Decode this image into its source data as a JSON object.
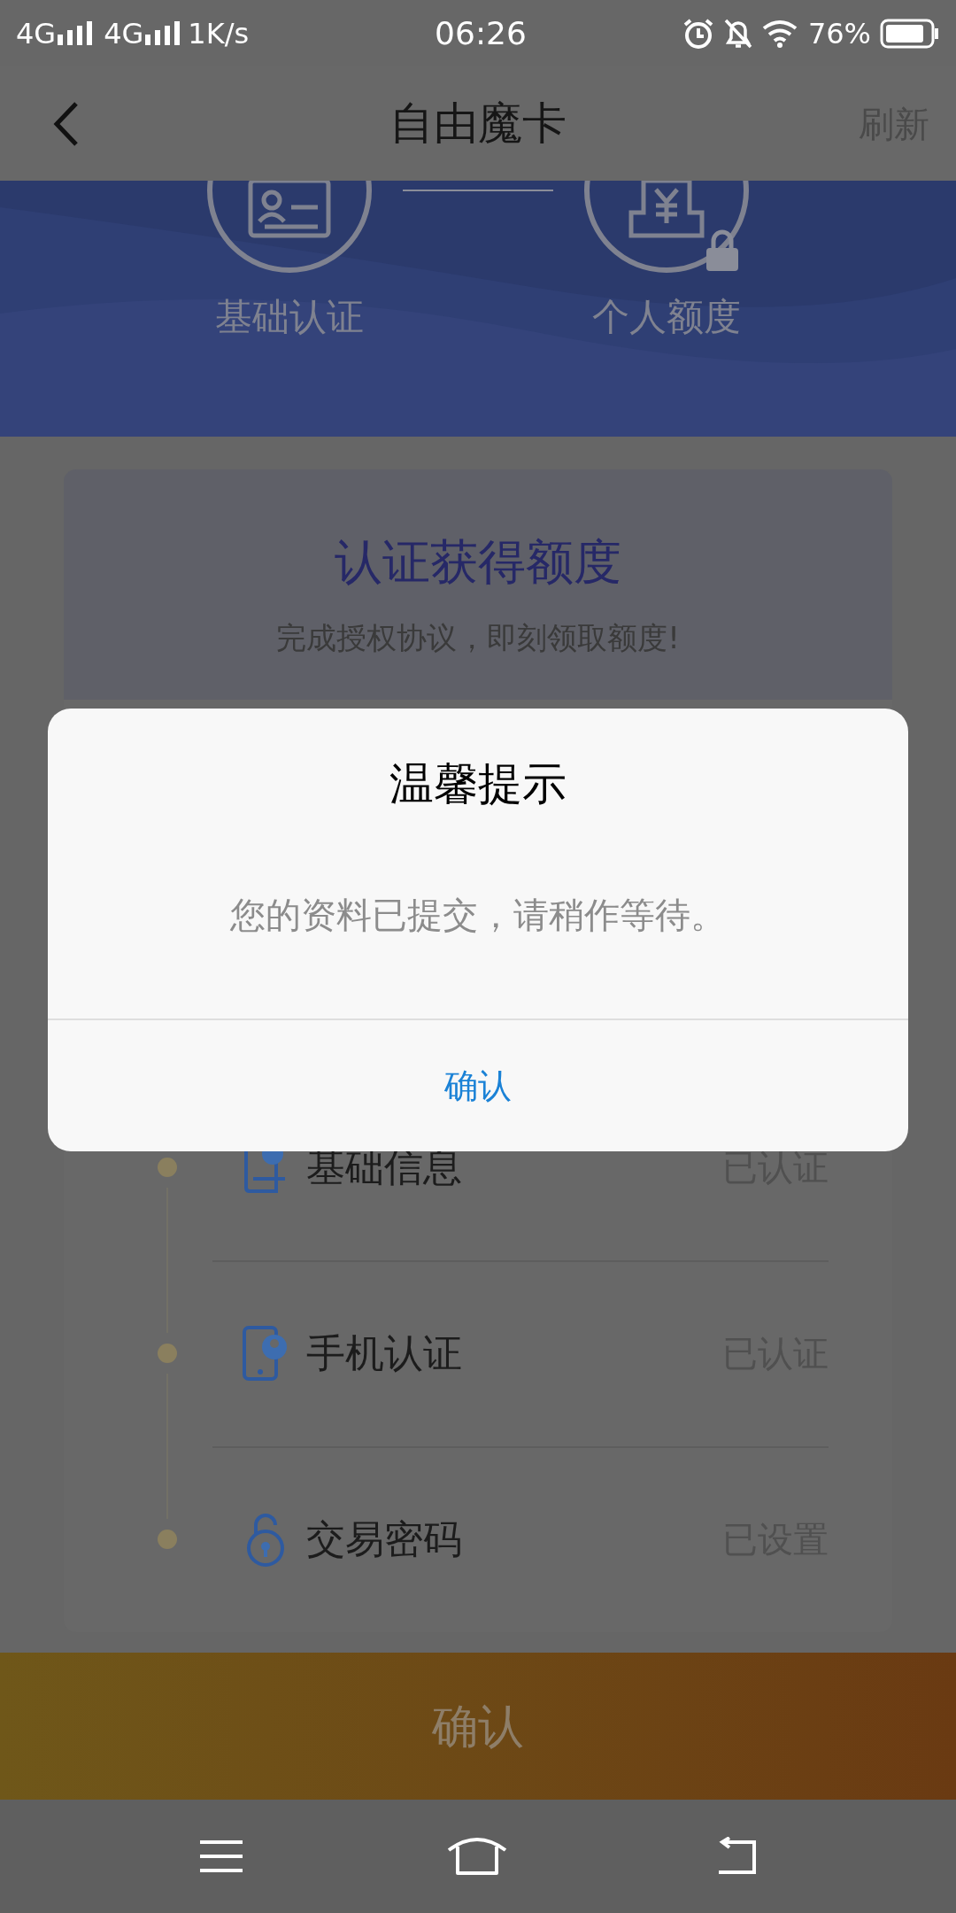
{
  "status_bar": {
    "signal_1": "4G",
    "signal_2": "4G",
    "speed": "1K/s",
    "time": "06:26",
    "battery": "76%"
  },
  "nav": {
    "title": "自由魔卡",
    "action": "刷新"
  },
  "steps": [
    {
      "label": "基础认证",
      "kind": "id-card",
      "locked": false
    },
    {
      "label": "个人额度",
      "kind": "money",
      "locked": true
    }
  ],
  "card": {
    "title": "认证获得额度",
    "subtitle": "完成授权协议，即刻领取额度!",
    "items": [
      {
        "name": "基础信息",
        "status": "已认证",
        "kind": "profile"
      },
      {
        "name": "手机认证",
        "status": "已认证",
        "kind": "phone"
      },
      {
        "name": "交易密码",
        "status": "已设置",
        "kind": "lock"
      }
    ]
  },
  "confirm_button": "确认",
  "dialog": {
    "title": "温馨提示",
    "message": "您的资料已提交，请稍作等待。",
    "button": "确认"
  }
}
